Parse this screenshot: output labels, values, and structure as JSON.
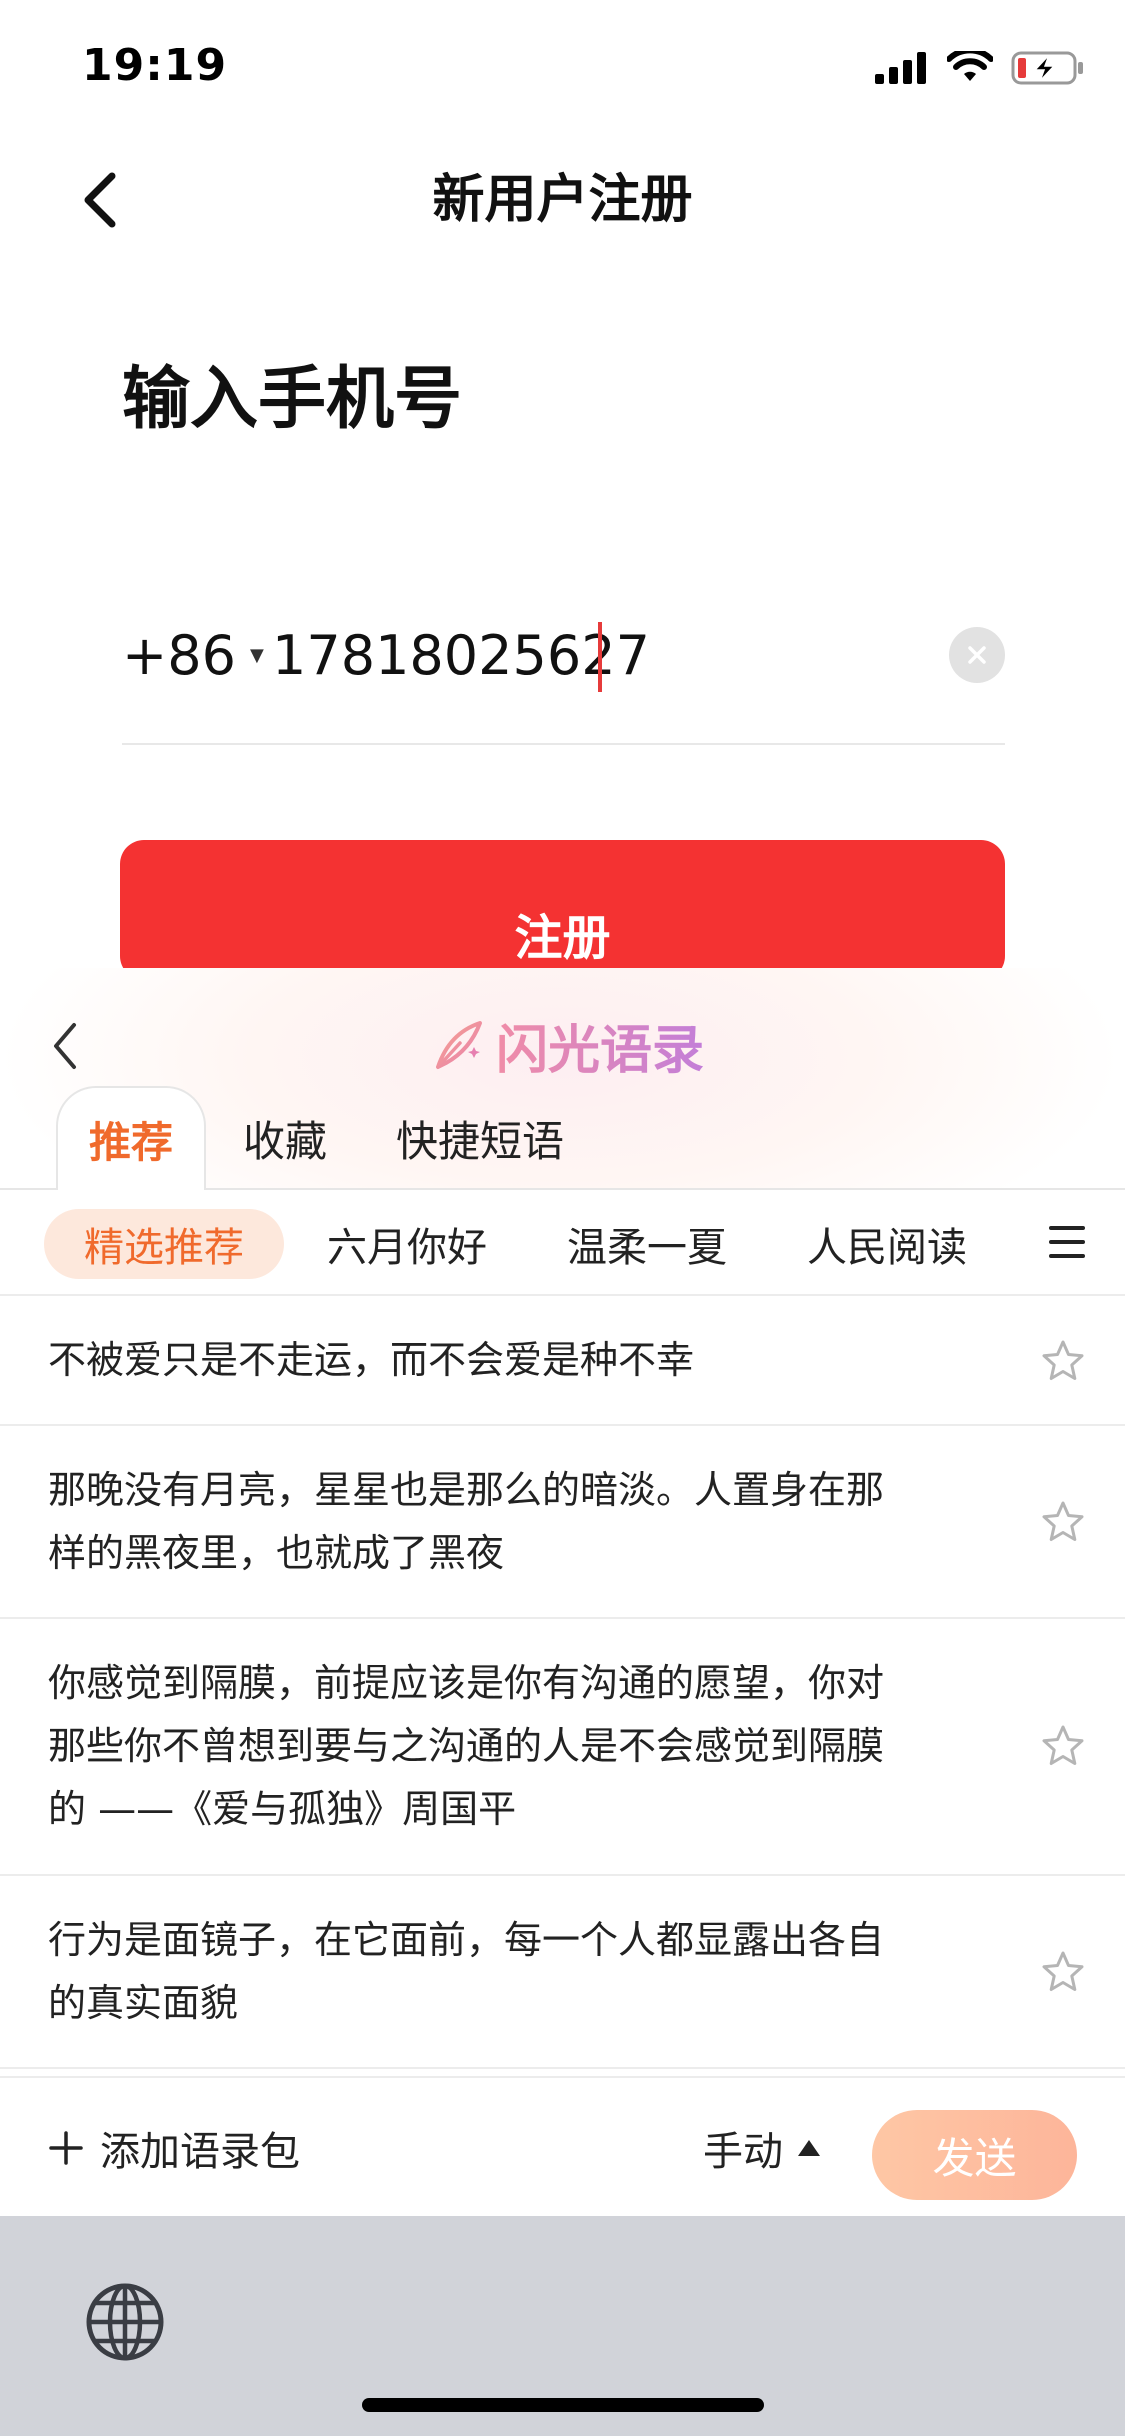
{
  "status_bar": {
    "time": "19:19",
    "icons": [
      "signal-icon",
      "wifi-icon",
      "battery-charging-icon"
    ],
    "battery_color": "#e63b3b"
  },
  "nav": {
    "title": "新用户注册",
    "back_icon": "chevron-left-icon"
  },
  "form": {
    "heading": "输入手机号",
    "country_code": "+86",
    "phone_value": "17818025627",
    "clear_icon": "clear-icon",
    "register_label": "注册",
    "accent_color": "#f43232"
  },
  "quote_panel": {
    "brand_name": "闪光语录",
    "brand_icon": "feather-quill-icon",
    "tabs": [
      {
        "label": "推荐",
        "active": true
      },
      {
        "label": "收藏",
        "active": false
      },
      {
        "label": "快捷短语",
        "active": false
      }
    ],
    "categories": [
      {
        "label": "精选推荐",
        "active": true
      },
      {
        "label": "六月你好",
        "active": false
      },
      {
        "label": "温柔一夏",
        "active": false
      },
      {
        "label": "人民阅读",
        "active": false
      }
    ],
    "menu_icon": "hamburger-menu-icon",
    "quotes": [
      {
        "lines": [
          "不被爱只是不走运，而不会爱是种不幸"
        ]
      },
      {
        "lines": [
          "那晚没有月亮，星星也是那么的暗淡。人置身在那",
          "样的黑夜里，也就成了黑夜"
        ]
      },
      {
        "lines": [
          "你感觉到隔膜，前提应该是你有沟通的愿望，你对",
          "那些你不曾想到要与之沟通的人是不会感觉到隔膜",
          "的 ——《爱与孤独》周国平"
        ]
      },
      {
        "lines": [
          "行为是面镜子，在它面前，每一个人都显露出各自",
          "的真实面貌"
        ]
      }
    ],
    "add_pack_label": "添加语录包",
    "mode_label": "手动",
    "send_label": "发送",
    "send_color": "#fdbb9f"
  },
  "keyboard": {
    "globe_icon": "globe-icon"
  }
}
